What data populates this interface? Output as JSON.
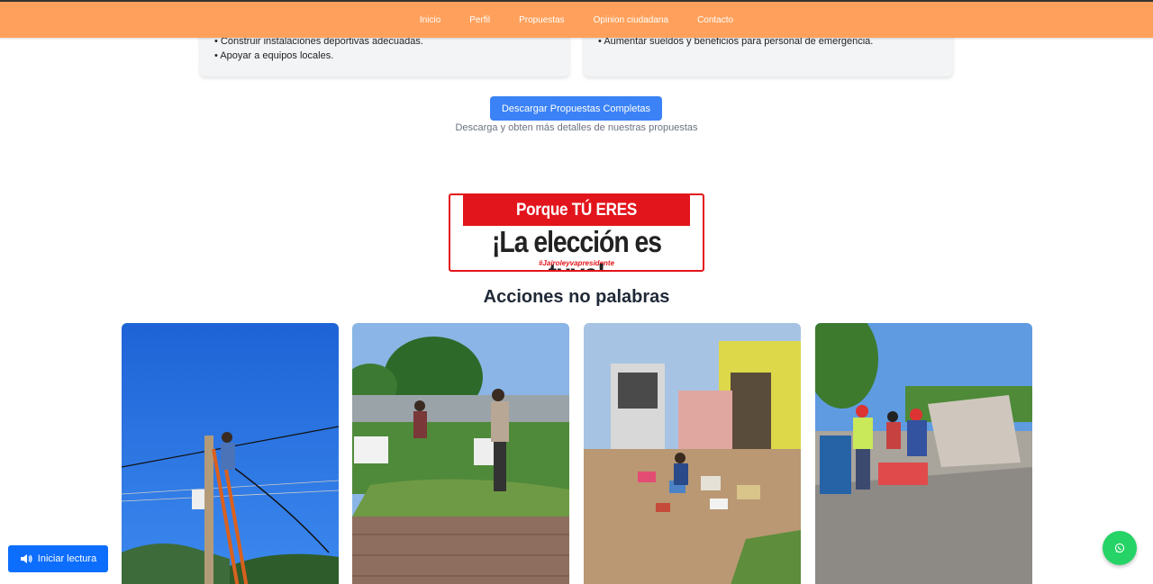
{
  "nav": {
    "items": [
      "Inicio",
      "Perfil",
      "Propuestas",
      "Opinion ciudadana",
      "Contacto"
    ]
  },
  "proposals": {
    "left": [
      "Construir instalaciones deportivas adecuadas.",
      "Apoyar a equipos locales."
    ],
    "right": [
      "Aumentar sueldos y beneficios para personal de emergencia."
    ]
  },
  "download": {
    "button_label": "Descargar Propuestas Completas",
    "hint": "Descarga y obten más detalles de nuestras propuestas"
  },
  "banner": {
    "line1": "Porque TÚ ERES INDEPENDIENTE",
    "line2": "¡La elección es tuya!",
    "hashtag": "#Jairoleyvapresidente"
  },
  "actions": {
    "title": "Acciones no palabras"
  },
  "read_aloud": {
    "label": "Iniciar lectura"
  },
  "colors": {
    "nav_bg": "#ffa15c",
    "primary": "#3b82f6",
    "banner_red": "#e3151c",
    "whatsapp": "#25d366"
  }
}
